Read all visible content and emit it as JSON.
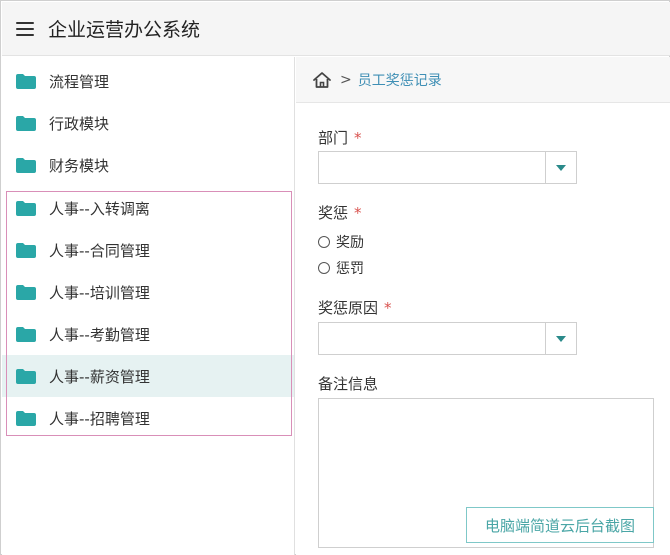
{
  "app": {
    "title": "企业运营办公系统"
  },
  "sidebar": {
    "items": [
      {
        "label": "流程管理",
        "active": false
      },
      {
        "label": "行政模块",
        "active": false
      },
      {
        "label": "财务模块",
        "active": false
      },
      {
        "label": "人事--入转调离",
        "active": false
      },
      {
        "label": "人事--合同管理",
        "active": false
      },
      {
        "label": "人事--培训管理",
        "active": false
      },
      {
        "label": "人事--考勤管理",
        "active": false
      },
      {
        "label": "人事--薪资管理",
        "active": true
      },
      {
        "label": "人事--招聘管理",
        "active": false
      }
    ],
    "folder_color": "#2aa7a7"
  },
  "breadcrumb": {
    "separator": ">",
    "current": "员工奖惩记录"
  },
  "form": {
    "required_mark": "*",
    "department": {
      "label": "部门",
      "value": ""
    },
    "reward_punish": {
      "label": "奖惩",
      "options": [
        "奖励",
        "惩罚"
      ]
    },
    "reason": {
      "label": "奖惩原因",
      "value": ""
    },
    "remarks": {
      "label": "备注信息",
      "value": ""
    }
  },
  "watermark": "电脑端简道云后台截图"
}
